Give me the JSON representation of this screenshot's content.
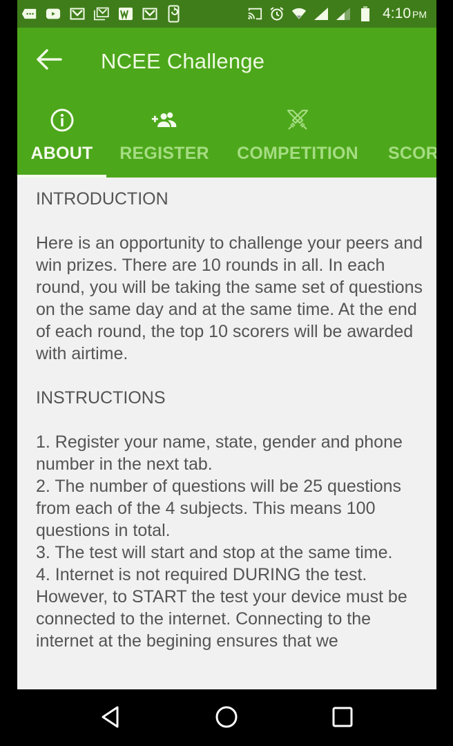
{
  "status_bar": {
    "time": "4:10",
    "ampm": "PM",
    "left_icons": [
      "messages-icon",
      "youtube-icon",
      "gmail-icon",
      "gmail-stack-icon",
      "word-icon",
      "gmail-icon",
      "phone-sync-icon"
    ],
    "right_icons": [
      "cast-icon",
      "alarm-icon",
      "wifi-icon",
      "signal-icon",
      "signal-weak-icon",
      "battery-icon"
    ]
  },
  "app_bar": {
    "title": "NCEE Challenge",
    "back_icon": "arrow-left-icon"
  },
  "tabs": [
    {
      "label": "ABOUT",
      "icon": "info-icon",
      "active": true
    },
    {
      "label": "REGISTER",
      "icon": "add-group-icon",
      "active": false
    },
    {
      "label": "COMPETITION",
      "icon": "crossed-swords-icon",
      "active": false
    },
    {
      "label": "SCOR",
      "icon": "scores-icon",
      "active": false
    }
  ],
  "content": {
    "intro_heading": "INTRODUCTION",
    "intro_text": "Here is an opportunity to challenge your peers and win prizes. There are 10 rounds in all. In each round, you will be taking the same set of questions on the same day and at the same time. At the end of each round, the top 10 scorers will be awarded with airtime.",
    "instructions_heading": "INSTRUCTIONS",
    "instructions": [
      "1. Register your name, state, gender and phone number in the next tab.",
      "2. The number of questions will be 25 questions from each of the 4 subjects. This means 100 questions in total.",
      "3. The test will start and stop at the same time.",
      "4. Internet is not required DURING the test. However, to START the test your device must be connected to the internet. Connecting to the internet at the begining ensures that we"
    ]
  },
  "nav_bar": {
    "buttons": [
      "back-icon",
      "home-icon",
      "recents-icon"
    ]
  },
  "colors": {
    "status_bar": "#3f7d1a",
    "app_bar": "#4da71b",
    "tab_active": "#f4fbee",
    "tab_inactive": "#a5dd82",
    "content_bg": "#f1f1f1",
    "content_text": "#545454"
  }
}
